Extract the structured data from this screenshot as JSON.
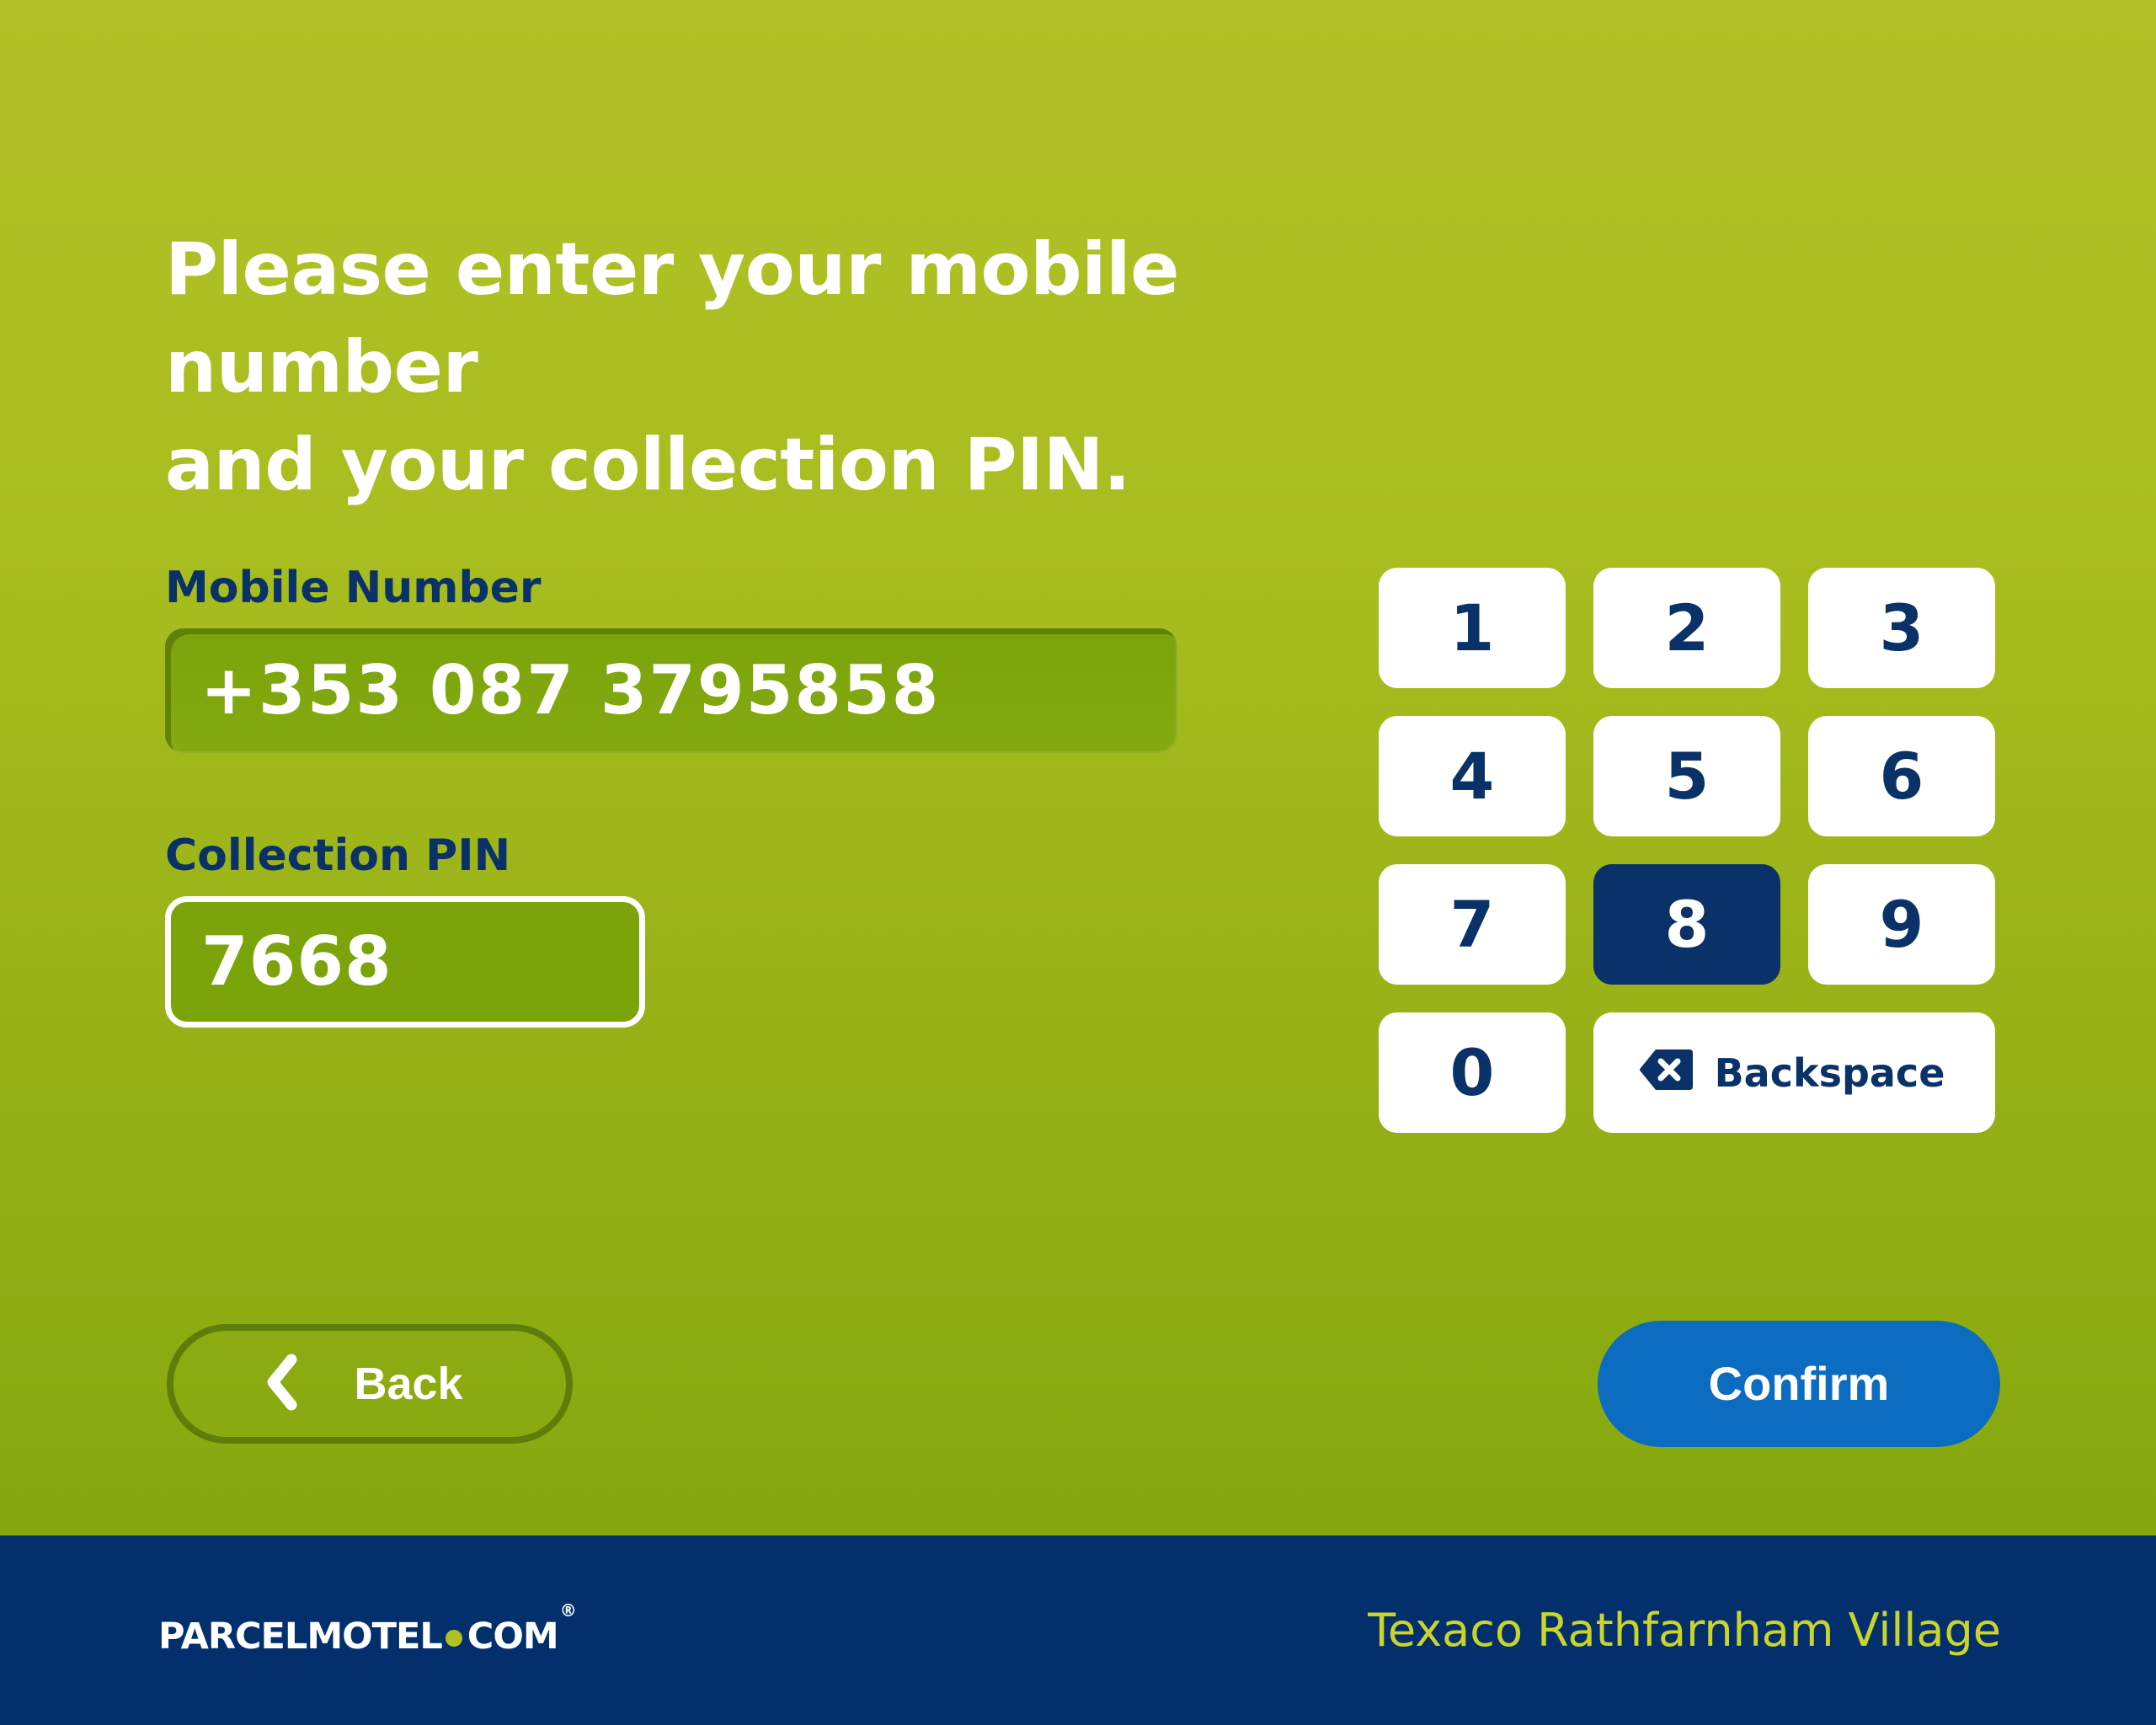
{
  "screen": {
    "background_top_color": "#b0c127",
    "background_bottom_color": "#7fa50c",
    "heading": "Please enter your mobile number\nand your collection PIN."
  },
  "form": {
    "mobile": {
      "label": "Mobile Number",
      "value": "+353 087 3795858",
      "placeholder": ""
    },
    "pin": {
      "label": "Collection PIN",
      "value": "7668",
      "placeholder": ""
    }
  },
  "keypad": {
    "keys": [
      {
        "label": "1",
        "name": "key-1",
        "active": false
      },
      {
        "label": "2",
        "name": "key-2",
        "active": false
      },
      {
        "label": "3",
        "name": "key-3",
        "active": false
      },
      {
        "label": "4",
        "name": "key-4",
        "active": false
      },
      {
        "label": "5",
        "name": "key-5",
        "active": false
      },
      {
        "label": "6",
        "name": "key-6",
        "active": false
      },
      {
        "label": "7",
        "name": "key-7",
        "active": false
      },
      {
        "label": "8",
        "name": "key-8",
        "active": true
      },
      {
        "label": "9",
        "name": "key-9",
        "active": false
      },
      {
        "label": "0",
        "name": "key-0",
        "active": false
      }
    ],
    "backspace": {
      "label": "Backspace",
      "icon": "backspace-icon"
    },
    "active_key_bg": "#0a3268",
    "key_bg": "#ffffff",
    "key_text_color": "#0a3268"
  },
  "actions": {
    "back": {
      "label": "Back",
      "icon": "chevron-left-icon"
    },
    "confirm": {
      "label": "Confirm",
      "color": "#0b6cc0"
    }
  },
  "footer": {
    "background_color": "#03306d",
    "logo": {
      "word1": "Parcel",
      "word2": "Motel",
      "word3": "com",
      "registered": "®"
    },
    "store_name": "Texaco Rathfarnham Village",
    "store_name_color": "#cbd42a"
  }
}
